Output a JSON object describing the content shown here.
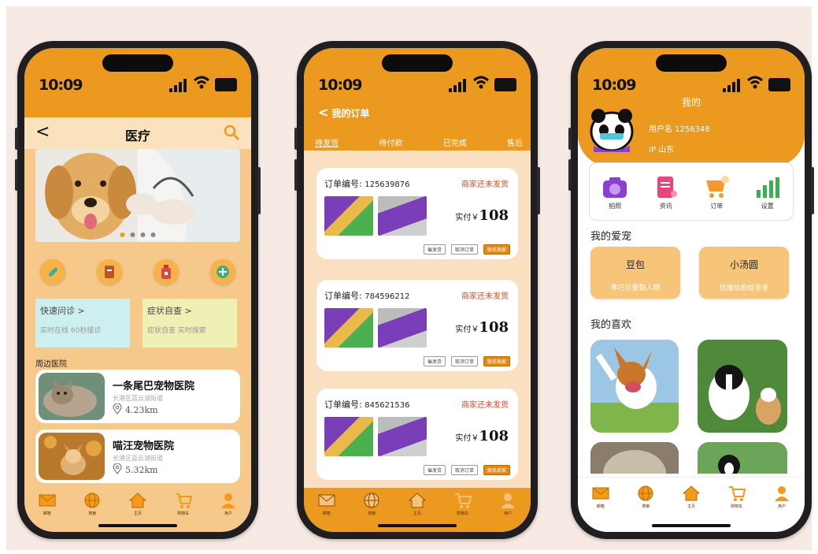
{
  "status_time": "10:09",
  "tabbar": [
    {
      "icon": "mail-icon",
      "label": "邮箱"
    },
    {
      "icon": "globe-icon",
      "label": "搜索"
    },
    {
      "icon": "home-icon",
      "label": "主页"
    },
    {
      "icon": "cart-icon",
      "label": "购物车"
    },
    {
      "icon": "user-icon",
      "label": "用户"
    }
  ],
  "medical": {
    "back": "<",
    "title": "医疗",
    "quick_consult": {
      "title": "快速问诊 >",
      "desc": "实时在线 60秒接诊"
    },
    "self_check": {
      "title": "症状自查 >",
      "desc": "症状自查 实时搜索"
    },
    "nearby_label": "周边医院",
    "hospitals": [
      {
        "name": "一条尾巴宠物医院",
        "addr": "长港区蓝云湖街道",
        "distance": "4.23km"
      },
      {
        "name": "喵汪宠物医院",
        "addr": "长港区蓝云湖街道",
        "distance": "5.32km"
      }
    ]
  },
  "orders": {
    "back": "<",
    "title": "我的订单",
    "tabs": [
      "待发货",
      "待付款",
      "已完成",
      "售后"
    ],
    "list": [
      {
        "label": "订单编号:",
        "number": "125639876",
        "status": "商家还未发货",
        "paid_label": "实付￥",
        "amount": "108"
      },
      {
        "label": "订单编号:",
        "number": "784596212",
        "status": "商家还未发货",
        "paid_label": "实付￥",
        "amount": "108"
      },
      {
        "label": "订单编号:",
        "number": "845621536",
        "status": "商家还未发货",
        "paid_label": "实付￥",
        "amount": "108"
      }
    ],
    "actions": [
      "催发货",
      "取消订单",
      "联系商家"
    ]
  },
  "profile": {
    "title": "我的",
    "username": "用户名 1256348",
    "ip": "IP 山东",
    "menu": [
      {
        "icon": "camera-icon",
        "label": "拍照",
        "color": "#8a3fd0"
      },
      {
        "icon": "news-icon",
        "label": "资讯",
        "color": "#e8457a"
      },
      {
        "icon": "order-cart-icon",
        "label": "订单",
        "color": "#f29a2e"
      },
      {
        "icon": "chart-icon",
        "label": "设置",
        "color": "#35b24a"
      }
    ],
    "my_pets_label": "我的爱宠",
    "pets": [
      {
        "name": "豆包",
        "desc": "乖巧可爱黏人精"
      },
      {
        "name": "小汤圆",
        "desc": "给撸给抱给亲亲"
      }
    ],
    "favorites_label": "我的喜欢"
  }
}
